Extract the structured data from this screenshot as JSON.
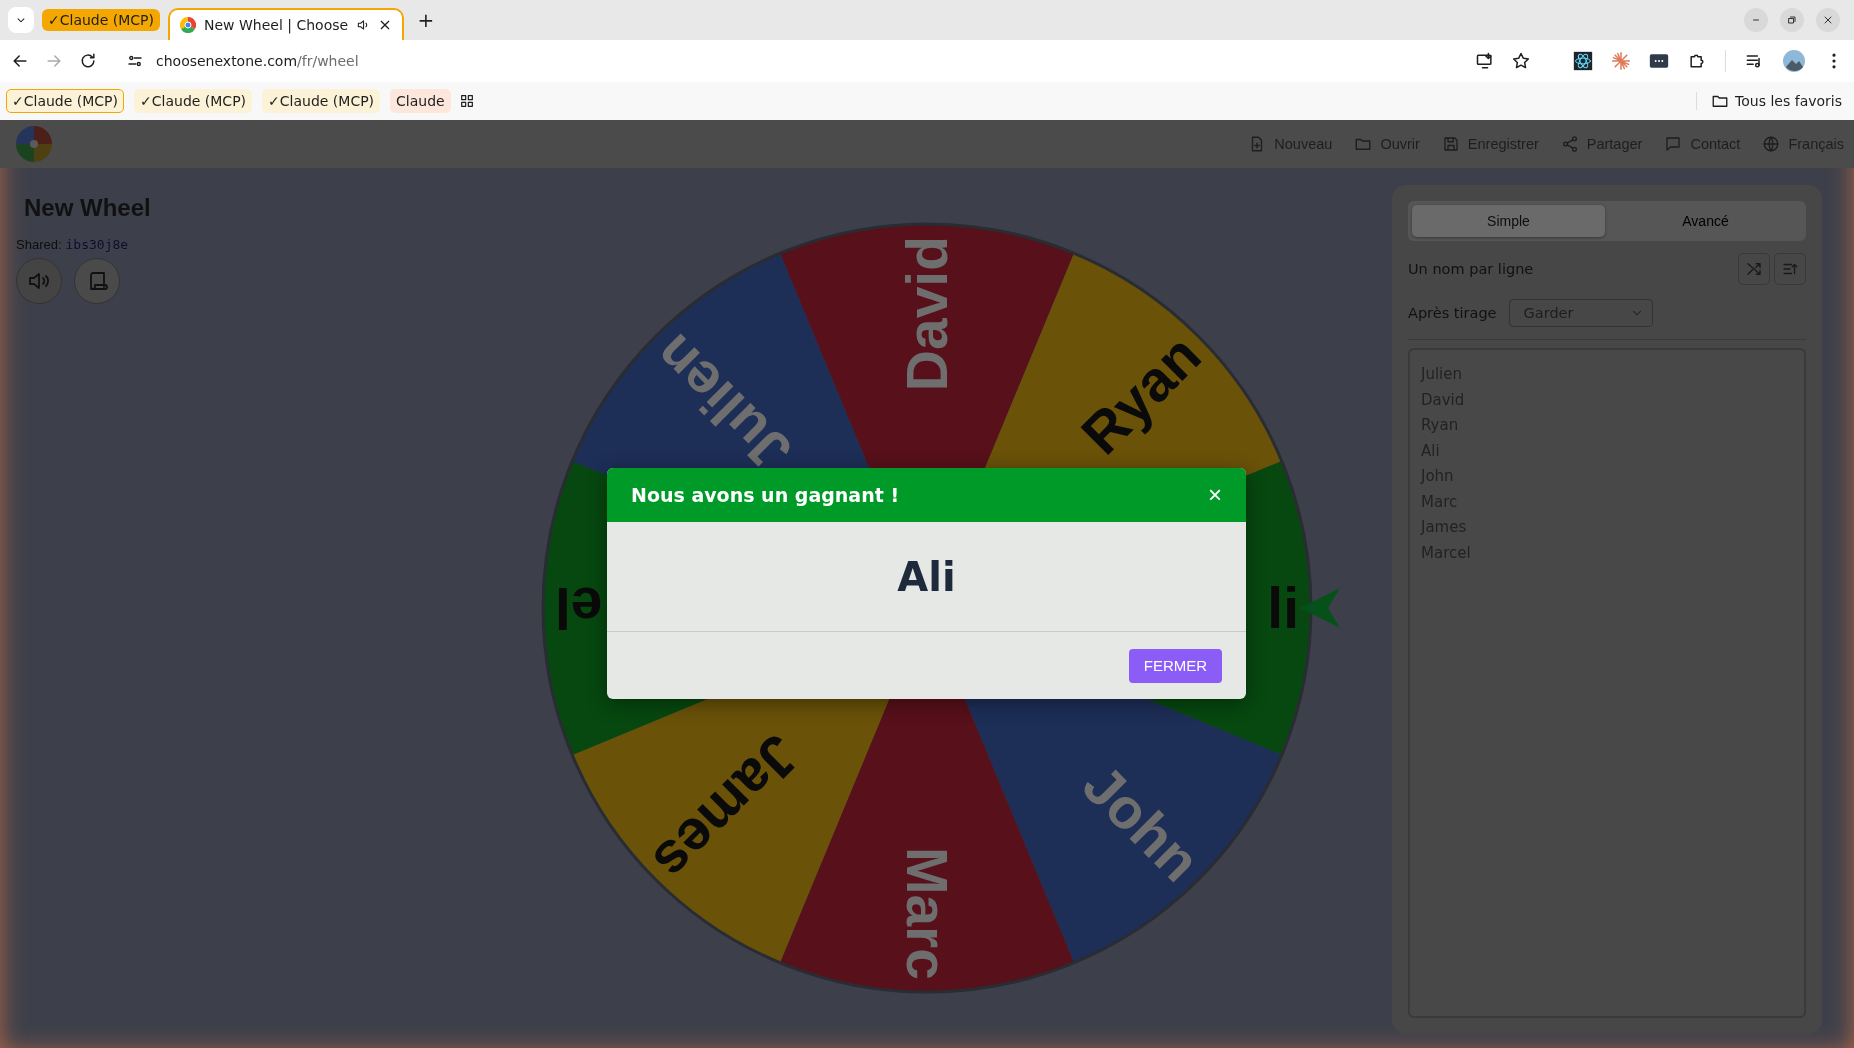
{
  "browser": {
    "tab_group": "✓Claude (MCP)",
    "tabs": [
      {
        "title": "New Wheel | Choose",
        "close": "×",
        "selected": true
      }
    ],
    "new_tab": "+",
    "address": {
      "host": "choosenextone.com",
      "path": "/fr/wheel"
    },
    "bookmarks": [
      {
        "label": "✓Claude (MCP)",
        "selected": true
      },
      {
        "label": "✓Claude (MCP)",
        "selected": false
      },
      {
        "label": "✓Claude (MCP)",
        "selected": false
      },
      {
        "label": "Claude",
        "selected": false
      }
    ],
    "all_bookmarks": "Tous les favoris"
  },
  "header": {
    "nav": [
      "Nouveau",
      "Ouvrir",
      "Enregistrer",
      "Partager",
      "Contact",
      "Français"
    ]
  },
  "wheel": {
    "title": "New Wheel",
    "shared_label": "Shared:",
    "shared_code": "ibs30j8e",
    "segments": [
      {
        "label": "David",
        "color": "#58101a"
      },
      {
        "label": "Ryan",
        "color": "#6a5208"
      },
      {
        "label": "li",
        "color": "#06480f"
      },
      {
        "label": "John",
        "color": "#1d2e57"
      },
      {
        "label": "Marc",
        "color": "#58101a"
      },
      {
        "label": "James",
        "color": "#6a5208"
      },
      {
        "label": "el",
        "color": "#06480f"
      },
      {
        "label": "Julien",
        "color": "#1d2e57"
      }
    ]
  },
  "panel": {
    "tabs": [
      {
        "label": "Simple",
        "selected": true
      },
      {
        "label": "Avancé",
        "selected": false
      }
    ],
    "names_label": "Un nom par ligne",
    "after_draw_label": "Après tirage",
    "after_draw_value": "Garder",
    "names": [
      "Julien",
      "David",
      "Ryan",
      "Ali",
      "John",
      "Marc",
      "James",
      "Marcel"
    ]
  },
  "modal": {
    "title": "Nous avons un gagnant !",
    "close": "×",
    "winner": "Ali",
    "button": "FERMER"
  }
}
